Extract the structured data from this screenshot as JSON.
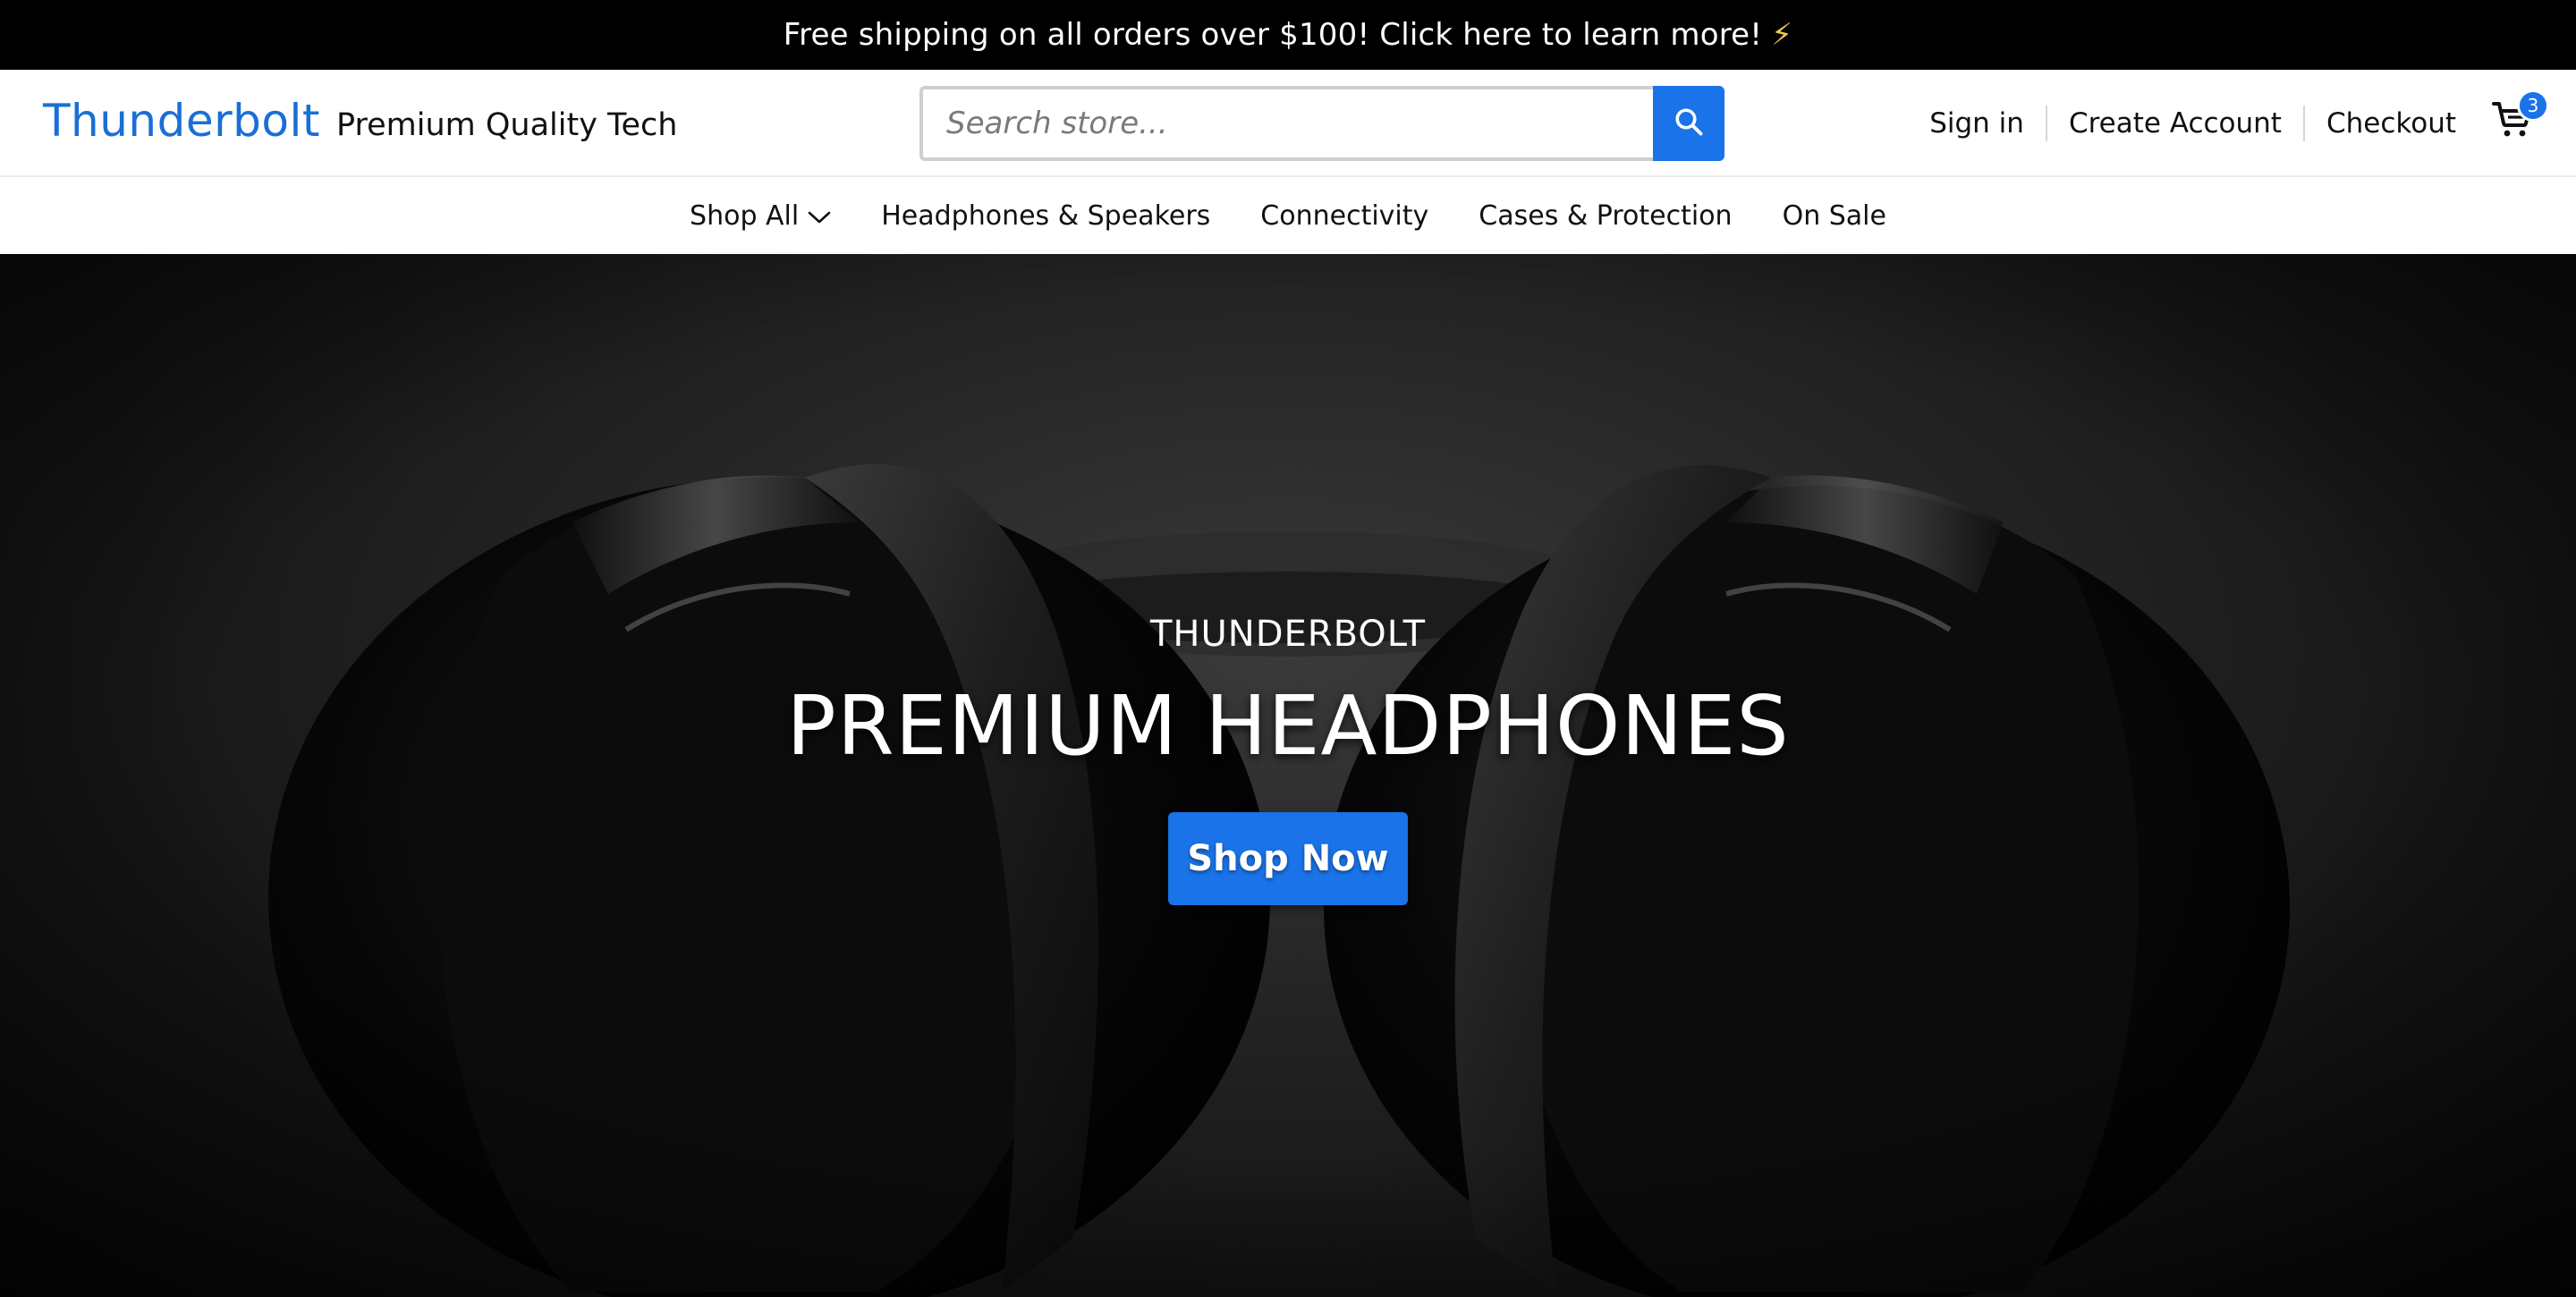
{
  "promo": {
    "text": "Free shipping on all orders over $100! Click here to learn more!",
    "icon": "lightning-bolt-icon"
  },
  "header": {
    "logo": "Thunderbolt",
    "tagline": "Premium Quality Tech",
    "search_placeholder": "Search store...",
    "sign_in": "Sign in",
    "create_account": "Create Account",
    "checkout": "Checkout",
    "cart_count": "3"
  },
  "nav": {
    "items": [
      "Shop All",
      "Headphones & Speakers",
      "Connectivity",
      "Cases & Protection",
      "On Sale"
    ]
  },
  "hero": {
    "eyebrow": "THUNDERBOLT",
    "headline": "PREMIUM HEADPHONES",
    "cta": "Shop Now"
  },
  "colors": {
    "brand": "#1a6fd6",
    "accent": "#1a73e8",
    "promo_bg": "#000000"
  }
}
